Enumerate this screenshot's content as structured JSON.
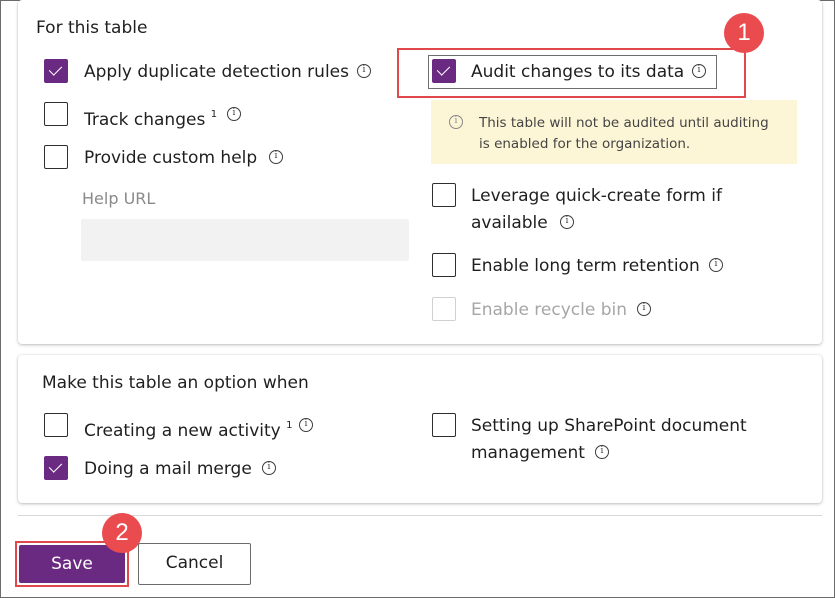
{
  "table_section": {
    "title": "For this table",
    "options": [
      {
        "label": "Apply duplicate detection rules",
        "checked": true
      },
      {
        "label": "Track changes",
        "sup": "1",
        "checked": false
      },
      {
        "label": "Provide custom help",
        "checked": false
      },
      {
        "label": "Audit changes to its data",
        "checked": true
      },
      {
        "label": "Leverage quick-create form if",
        "label2": "available",
        "checked": false
      },
      {
        "label": "Enable long term retention",
        "checked": false
      },
      {
        "label": "Enable recycle bin",
        "checked": false,
        "disabled": true
      }
    ],
    "help_url_label": "Help URL",
    "help_url_value": "",
    "audit_warning_line1": "This table will not be audited until auditing",
    "audit_warning_line2": "is enabled for the organization."
  },
  "option_section": {
    "title": "Make this table an option when",
    "options": [
      {
        "label": "Creating a new activity",
        "sup": "1",
        "checked": false
      },
      {
        "label": "Doing a mail merge",
        "checked": true
      },
      {
        "label": "Setting up SharePoint document",
        "label2": "management",
        "checked": false
      }
    ]
  },
  "footer": {
    "save_label": "Save",
    "cancel_label": "Cancel"
  },
  "callouts": [
    "1",
    "2"
  ],
  "colors": {
    "accent": "#6b2a82",
    "callout": "#ea4b4e",
    "warning_bg": "#fdf6d6"
  }
}
